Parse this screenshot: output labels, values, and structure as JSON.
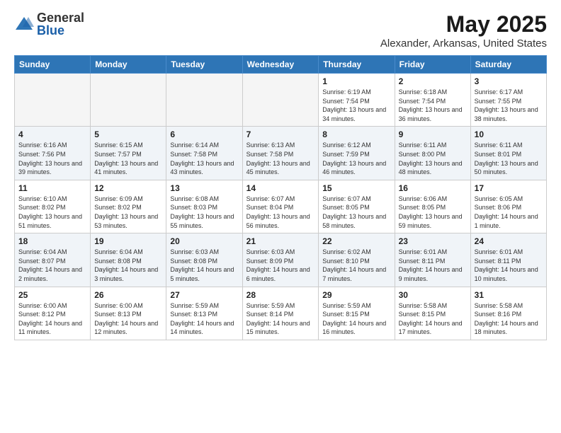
{
  "logo": {
    "general": "General",
    "blue": "Blue"
  },
  "title": {
    "month": "May 2025",
    "location": "Alexander, Arkansas, United States"
  },
  "weekdays": [
    "Sunday",
    "Monday",
    "Tuesday",
    "Wednesday",
    "Thursday",
    "Friday",
    "Saturday"
  ],
  "weeks": [
    [
      {
        "day": "",
        "sunrise": "",
        "sunset": "",
        "daylight": "",
        "empty": true
      },
      {
        "day": "",
        "sunrise": "",
        "sunset": "",
        "daylight": "",
        "empty": true
      },
      {
        "day": "",
        "sunrise": "",
        "sunset": "",
        "daylight": "",
        "empty": true
      },
      {
        "day": "",
        "sunrise": "",
        "sunset": "",
        "daylight": "",
        "empty": true
      },
      {
        "day": "1",
        "sunrise": "Sunrise: 6:19 AM",
        "sunset": "Sunset: 7:54 PM",
        "daylight": "Daylight: 13 hours and 34 minutes.",
        "empty": false
      },
      {
        "day": "2",
        "sunrise": "Sunrise: 6:18 AM",
        "sunset": "Sunset: 7:54 PM",
        "daylight": "Daylight: 13 hours and 36 minutes.",
        "empty": false
      },
      {
        "day": "3",
        "sunrise": "Sunrise: 6:17 AM",
        "sunset": "Sunset: 7:55 PM",
        "daylight": "Daylight: 13 hours and 38 minutes.",
        "empty": false
      }
    ],
    [
      {
        "day": "4",
        "sunrise": "Sunrise: 6:16 AM",
        "sunset": "Sunset: 7:56 PM",
        "daylight": "Daylight: 13 hours and 39 minutes.",
        "empty": false
      },
      {
        "day": "5",
        "sunrise": "Sunrise: 6:15 AM",
        "sunset": "Sunset: 7:57 PM",
        "daylight": "Daylight: 13 hours and 41 minutes.",
        "empty": false
      },
      {
        "day": "6",
        "sunrise": "Sunrise: 6:14 AM",
        "sunset": "Sunset: 7:58 PM",
        "daylight": "Daylight: 13 hours and 43 minutes.",
        "empty": false
      },
      {
        "day": "7",
        "sunrise": "Sunrise: 6:13 AM",
        "sunset": "Sunset: 7:58 PM",
        "daylight": "Daylight: 13 hours and 45 minutes.",
        "empty": false
      },
      {
        "day": "8",
        "sunrise": "Sunrise: 6:12 AM",
        "sunset": "Sunset: 7:59 PM",
        "daylight": "Daylight: 13 hours and 46 minutes.",
        "empty": false
      },
      {
        "day": "9",
        "sunrise": "Sunrise: 6:11 AM",
        "sunset": "Sunset: 8:00 PM",
        "daylight": "Daylight: 13 hours and 48 minutes.",
        "empty": false
      },
      {
        "day": "10",
        "sunrise": "Sunrise: 6:11 AM",
        "sunset": "Sunset: 8:01 PM",
        "daylight": "Daylight: 13 hours and 50 minutes.",
        "empty": false
      }
    ],
    [
      {
        "day": "11",
        "sunrise": "Sunrise: 6:10 AM",
        "sunset": "Sunset: 8:02 PM",
        "daylight": "Daylight: 13 hours and 51 minutes.",
        "empty": false
      },
      {
        "day": "12",
        "sunrise": "Sunrise: 6:09 AM",
        "sunset": "Sunset: 8:02 PM",
        "daylight": "Daylight: 13 hours and 53 minutes.",
        "empty": false
      },
      {
        "day": "13",
        "sunrise": "Sunrise: 6:08 AM",
        "sunset": "Sunset: 8:03 PM",
        "daylight": "Daylight: 13 hours and 55 minutes.",
        "empty": false
      },
      {
        "day": "14",
        "sunrise": "Sunrise: 6:07 AM",
        "sunset": "Sunset: 8:04 PM",
        "daylight": "Daylight: 13 hours and 56 minutes.",
        "empty": false
      },
      {
        "day": "15",
        "sunrise": "Sunrise: 6:07 AM",
        "sunset": "Sunset: 8:05 PM",
        "daylight": "Daylight: 13 hours and 58 minutes.",
        "empty": false
      },
      {
        "day": "16",
        "sunrise": "Sunrise: 6:06 AM",
        "sunset": "Sunset: 8:05 PM",
        "daylight": "Daylight: 13 hours and 59 minutes.",
        "empty": false
      },
      {
        "day": "17",
        "sunrise": "Sunrise: 6:05 AM",
        "sunset": "Sunset: 8:06 PM",
        "daylight": "Daylight: 14 hours and 1 minute.",
        "empty": false
      }
    ],
    [
      {
        "day": "18",
        "sunrise": "Sunrise: 6:04 AM",
        "sunset": "Sunset: 8:07 PM",
        "daylight": "Daylight: 14 hours and 2 minutes.",
        "empty": false
      },
      {
        "day": "19",
        "sunrise": "Sunrise: 6:04 AM",
        "sunset": "Sunset: 8:08 PM",
        "daylight": "Daylight: 14 hours and 3 minutes.",
        "empty": false
      },
      {
        "day": "20",
        "sunrise": "Sunrise: 6:03 AM",
        "sunset": "Sunset: 8:08 PM",
        "daylight": "Daylight: 14 hours and 5 minutes.",
        "empty": false
      },
      {
        "day": "21",
        "sunrise": "Sunrise: 6:03 AM",
        "sunset": "Sunset: 8:09 PM",
        "daylight": "Daylight: 14 hours and 6 minutes.",
        "empty": false
      },
      {
        "day": "22",
        "sunrise": "Sunrise: 6:02 AM",
        "sunset": "Sunset: 8:10 PM",
        "daylight": "Daylight: 14 hours and 7 minutes.",
        "empty": false
      },
      {
        "day": "23",
        "sunrise": "Sunrise: 6:01 AM",
        "sunset": "Sunset: 8:11 PM",
        "daylight": "Daylight: 14 hours and 9 minutes.",
        "empty": false
      },
      {
        "day": "24",
        "sunrise": "Sunrise: 6:01 AM",
        "sunset": "Sunset: 8:11 PM",
        "daylight": "Daylight: 14 hours and 10 minutes.",
        "empty": false
      }
    ],
    [
      {
        "day": "25",
        "sunrise": "Sunrise: 6:00 AM",
        "sunset": "Sunset: 8:12 PM",
        "daylight": "Daylight: 14 hours and 11 minutes.",
        "empty": false
      },
      {
        "day": "26",
        "sunrise": "Sunrise: 6:00 AM",
        "sunset": "Sunset: 8:13 PM",
        "daylight": "Daylight: 14 hours and 12 minutes.",
        "empty": false
      },
      {
        "day": "27",
        "sunrise": "Sunrise: 5:59 AM",
        "sunset": "Sunset: 8:13 PM",
        "daylight": "Daylight: 14 hours and 14 minutes.",
        "empty": false
      },
      {
        "day": "28",
        "sunrise": "Sunrise: 5:59 AM",
        "sunset": "Sunset: 8:14 PM",
        "daylight": "Daylight: 14 hours and 15 minutes.",
        "empty": false
      },
      {
        "day": "29",
        "sunrise": "Sunrise: 5:59 AM",
        "sunset": "Sunset: 8:15 PM",
        "daylight": "Daylight: 14 hours and 16 minutes.",
        "empty": false
      },
      {
        "day": "30",
        "sunrise": "Sunrise: 5:58 AM",
        "sunset": "Sunset: 8:15 PM",
        "daylight": "Daylight: 14 hours and 17 minutes.",
        "empty": false
      },
      {
        "day": "31",
        "sunrise": "Sunrise: 5:58 AM",
        "sunset": "Sunset: 8:16 PM",
        "daylight": "Daylight: 14 hours and 18 minutes.",
        "empty": false
      }
    ]
  ]
}
